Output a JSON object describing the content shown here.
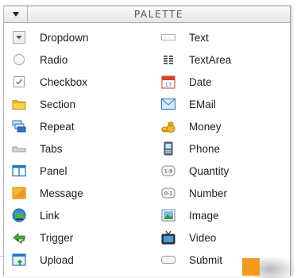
{
  "palette": {
    "title": "PALETTE",
    "left_items": [
      {
        "label": "Dropdown",
        "icon": "dropdown-icon"
      },
      {
        "label": "Radio",
        "icon": "radio-icon"
      },
      {
        "label": "Checkbox",
        "icon": "checkbox-icon"
      },
      {
        "label": "Section",
        "icon": "folder-icon"
      },
      {
        "label": "Repeat",
        "icon": "repeat-icon"
      },
      {
        "label": "Tabs",
        "icon": "tabs-icon"
      },
      {
        "label": "Panel",
        "icon": "panel-icon"
      },
      {
        "label": "Message",
        "icon": "message-icon"
      },
      {
        "label": "Link",
        "icon": "link-icon"
      },
      {
        "label": "Trigger",
        "icon": "trigger-icon"
      },
      {
        "label": "Upload",
        "icon": "upload-icon"
      }
    ],
    "right_items": [
      {
        "label": "Text",
        "icon": "text-icon"
      },
      {
        "label": "TextArea",
        "icon": "textarea-icon"
      },
      {
        "label": "Date",
        "icon": "calendar-icon"
      },
      {
        "label": "EMail",
        "icon": "email-icon"
      },
      {
        "label": "Money",
        "icon": "money-icon"
      },
      {
        "label": "Phone",
        "icon": "phone-icon"
      },
      {
        "label": "Quantity",
        "icon": "quantity-icon"
      },
      {
        "label": "Number",
        "icon": "number-icon"
      },
      {
        "label": "Image",
        "icon": "image-icon"
      },
      {
        "label": "Video",
        "icon": "video-icon"
      },
      {
        "label": "Submit",
        "icon": "submit-icon"
      }
    ],
    "date_icon_text": "17",
    "quantity_icon_text": "1-9",
    "number_icon_text": "0-1"
  },
  "colors": {
    "header_text": "#555555",
    "folder": "#f2c21c",
    "accent_blue": "#2a73c4",
    "orange_marker": "#f39a1e"
  }
}
